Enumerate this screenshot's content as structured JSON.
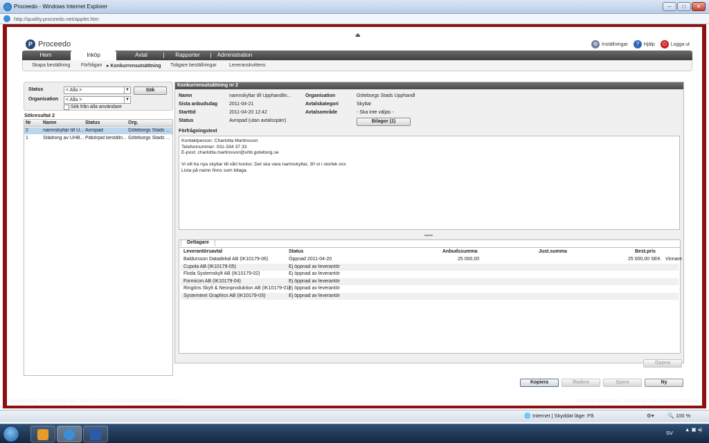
{
  "window": {
    "title": "Proceedo - Windows Internet Explorer",
    "url": "http://quality.proceedo.net/applet.htm"
  },
  "app": {
    "name": "Proceedo",
    "links": {
      "settings": "Inställningar",
      "help": "Hjälp",
      "logout": "Logga ut"
    }
  },
  "mainnav": {
    "items": [
      "Hem",
      "Inköp",
      "Avtal",
      "Rapporter",
      "Administration"
    ],
    "selected": "Inköp"
  },
  "subnav": {
    "items": [
      "Skapa beställning",
      "Förfrågan",
      "Konkurrensutsättning",
      "Tidigare beställningar",
      "Leveranskvittens"
    ],
    "selected": "Konkurrensutsättning"
  },
  "search": {
    "status_label": "Status",
    "status_value": "< Alla >",
    "org_label": "Organisation",
    "org_value": "< Alla >",
    "search_button": "Sök",
    "all_users_label": "Sök från alla användare"
  },
  "results": {
    "label": "Sökresultat 2",
    "columns": [
      "Nr",
      "Namn",
      "Status",
      "Org."
    ],
    "rows": [
      {
        "nr": "2",
        "name": "namnskyltar till U...",
        "status": "Avropad",
        "org": "Göteborgs Stads ..."
      },
      {
        "nr": "1",
        "name": "Städning av UHB...",
        "status": "Påbörjad beställn...",
        "org": "Göteborgs Stads ..."
      }
    ]
  },
  "detail": {
    "title": "Konkurrensutsättning nr 2",
    "fields": {
      "namn_label": "Namn",
      "namn": "namnskyltar till Upphandlin...",
      "sista_label": "Sista anbudsdag",
      "sista": "2011-04-21",
      "start_label": "Starttid",
      "start": "2011-04-20 12:42",
      "status_label": "Status",
      "status": "Avropad (utan avtalsspärr)",
      "org_label": "Organisation",
      "org": "Göteborgs Stads Upphandl",
      "kat_label": "Avtalskategori",
      "kat": "Skyltar",
      "omr_label": "Avtalsområde",
      "omr": "- Ska inte väljas -"
    },
    "bilagor_button": "Bilagor (1)",
    "text_label": "Förfrågningstext",
    "text_lines": [
      "Kontaktperson: Charlotta Martinsson",
      "Telefonnummer: 031-334 37 33",
      "E-post: charlotta.martinsson@uhb.goteborg.se",
      "",
      "Vi vill ha nya skyltar till vårt kontor. Det ska vara namnskyltar, 30 st i storlek xxx",
      "Lista på namn finns som bilaga."
    ]
  },
  "participants": {
    "tab": "Deltagare",
    "columns": [
      "Leverantörsavtal",
      "Status",
      "Anbudssumma",
      "Just.summa",
      "Best.pris"
    ],
    "rows": [
      {
        "avtal": "Baldursson Datadekal AB (IK10179-06)",
        "status": "Öppnad 2011-04-20",
        "anbud": "25 000,00",
        "just": "",
        "best": "25 000,00 SEK",
        "extra": "Vinnare"
      },
      {
        "avtal": "Cupola AB (IK10179-05)",
        "status": "Ej öppnad av leverantör",
        "anbud": "",
        "just": "",
        "best": "",
        "extra": ""
      },
      {
        "avtal": "Floda Systemskylt AB (IK10179-02)",
        "status": "Ej öppnad av leverantör",
        "anbud": "",
        "just": "",
        "best": "",
        "extra": ""
      },
      {
        "avtal": "Formicon AB (IK10179-04)",
        "status": "Ej öppnad av leverantör",
        "anbud": "",
        "just": "",
        "best": "",
        "extra": ""
      },
      {
        "avtal": "Ringöns Skylt & Neonproduktion AB (IK10179-01)",
        "status": "Ej öppnad av leverantör",
        "anbud": "",
        "just": "",
        "best": "",
        "extra": ""
      },
      {
        "avtal": "Systemtext Graphics AB (IK10179-03)",
        "status": "Ej öppnad av leverantör",
        "anbud": "",
        "just": "",
        "best": "",
        "extra": ""
      }
    ]
  },
  "buttons": {
    "open": "Öppna",
    "copy": "Kopiera",
    "delete": "Radera",
    "save": "Spara",
    "new": "Ny"
  },
  "footer": {
    "left": "Service Desk Telefon UHB adm: 031-3343725   E-post nosend@nosend.nosend",
    "right": "Charlotta Martinsson / Göteborgs Stads Upphandlings AB"
  },
  "statusbar": {
    "zone": "Internet | Skyddat läge: På",
    "zoom": "100 %"
  },
  "taskbar": {
    "lang": "SV"
  }
}
